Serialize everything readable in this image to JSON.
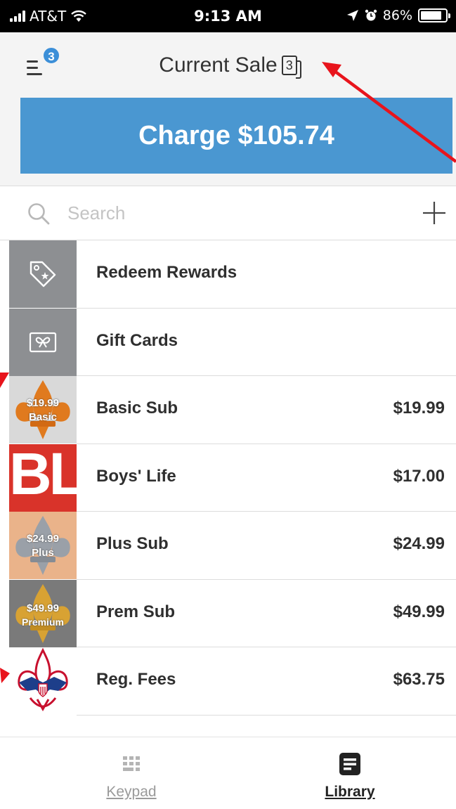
{
  "status_bar": {
    "carrier": "AT&T",
    "time": "9:13 AM",
    "battery_percent": "86%",
    "battery_level": 0.86,
    "icons": [
      "signal-icon",
      "wifi-icon",
      "location-icon",
      "alarm-icon",
      "battery-icon"
    ]
  },
  "header": {
    "menu_badge": "3",
    "title": "Current Sale",
    "item_count": "3"
  },
  "charge": {
    "label": "Charge $105.74"
  },
  "search": {
    "placeholder": "Search"
  },
  "library": {
    "items": [
      {
        "label": "Redeem Rewards",
        "price": "",
        "icon": "reward-tag-icon"
      },
      {
        "label": "Gift Cards",
        "price": "",
        "icon": "gift-card-icon"
      },
      {
        "label": "Basic Sub",
        "price": "$19.99",
        "thumb_text": [
          "$19.99",
          "Basic"
        ]
      },
      {
        "label": "Boys' Life",
        "price": "$17.00",
        "thumb_text": [
          "BL"
        ]
      },
      {
        "label": "Plus Sub",
        "price": "$24.99",
        "thumb_text": [
          "$24.99",
          "Plus"
        ]
      },
      {
        "label": "Prem Sub",
        "price": "$49.99",
        "thumb_text": [
          "$49.99",
          "Premium"
        ]
      },
      {
        "label": "Reg. Fees",
        "price": "$63.75"
      }
    ]
  },
  "tabs": {
    "keypad": "Keypad",
    "library": "Library"
  },
  "colors": {
    "accent": "#4a97d1",
    "badge": "#3c8fd8",
    "annotation": "#e8141c",
    "thumb_gray": "#8d8f92"
  }
}
